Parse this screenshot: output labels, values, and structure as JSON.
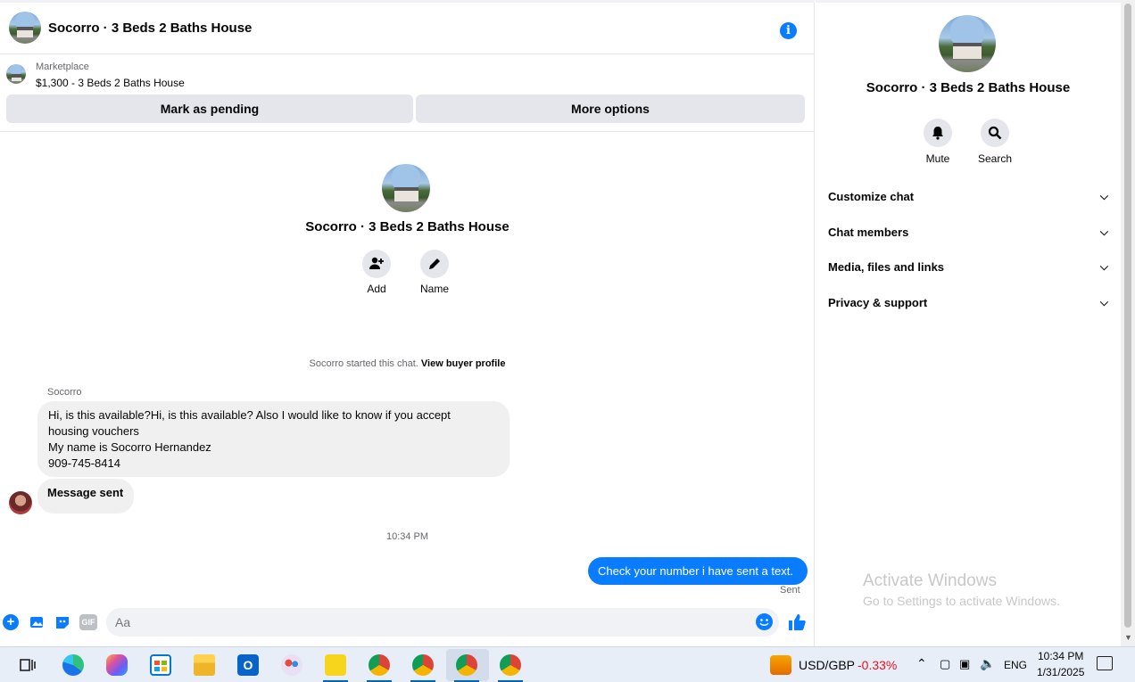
{
  "header": {
    "title": "Socorro · 3 Beds 2 Baths House",
    "info_icon": "info-icon"
  },
  "listing": {
    "source": "Marketplace",
    "price_title": "$1,300 - 3 Beds 2 Baths House",
    "btn_pending": "Mark as pending",
    "btn_more": "More options"
  },
  "chat": {
    "title": "Socorro · 3 Beds 2 Baths House",
    "add_label": "Add",
    "name_label": "Name",
    "system_text": "Socorro started this chat.",
    "system_link": "View buyer profile",
    "sender_name": "Socorro",
    "message_lines": [
      "Hi, is this available?Hi, is this available? Also I would like to know if you accept",
      "housing vouchers",
      "My name is Socorro Hernandez",
      "909-745-8414"
    ],
    "message_sent": "Message sent",
    "timestamp": "10:34 PM",
    "outgoing": "Check your number i have sent a text.",
    "status": "Sent",
    "composer_placeholder": "Aa"
  },
  "sidebar": {
    "title": "Socorro · 3 Beds 2 Baths House",
    "mute": "Mute",
    "search": "Search",
    "sections": [
      "Customize chat",
      "Chat members",
      "Media, files and links",
      "Privacy & support"
    ]
  },
  "watermark": {
    "line1": "Activate Windows",
    "line2": "Go to Settings to activate Windows."
  },
  "taskbar": {
    "ticker": "USD/GBP",
    "change": "-0.33%",
    "lang": "ENG",
    "time": "10:34 PM",
    "date": "1/31/2025"
  },
  "colors": {
    "accent": "#0a7cff",
    "negative": "#e81123"
  }
}
